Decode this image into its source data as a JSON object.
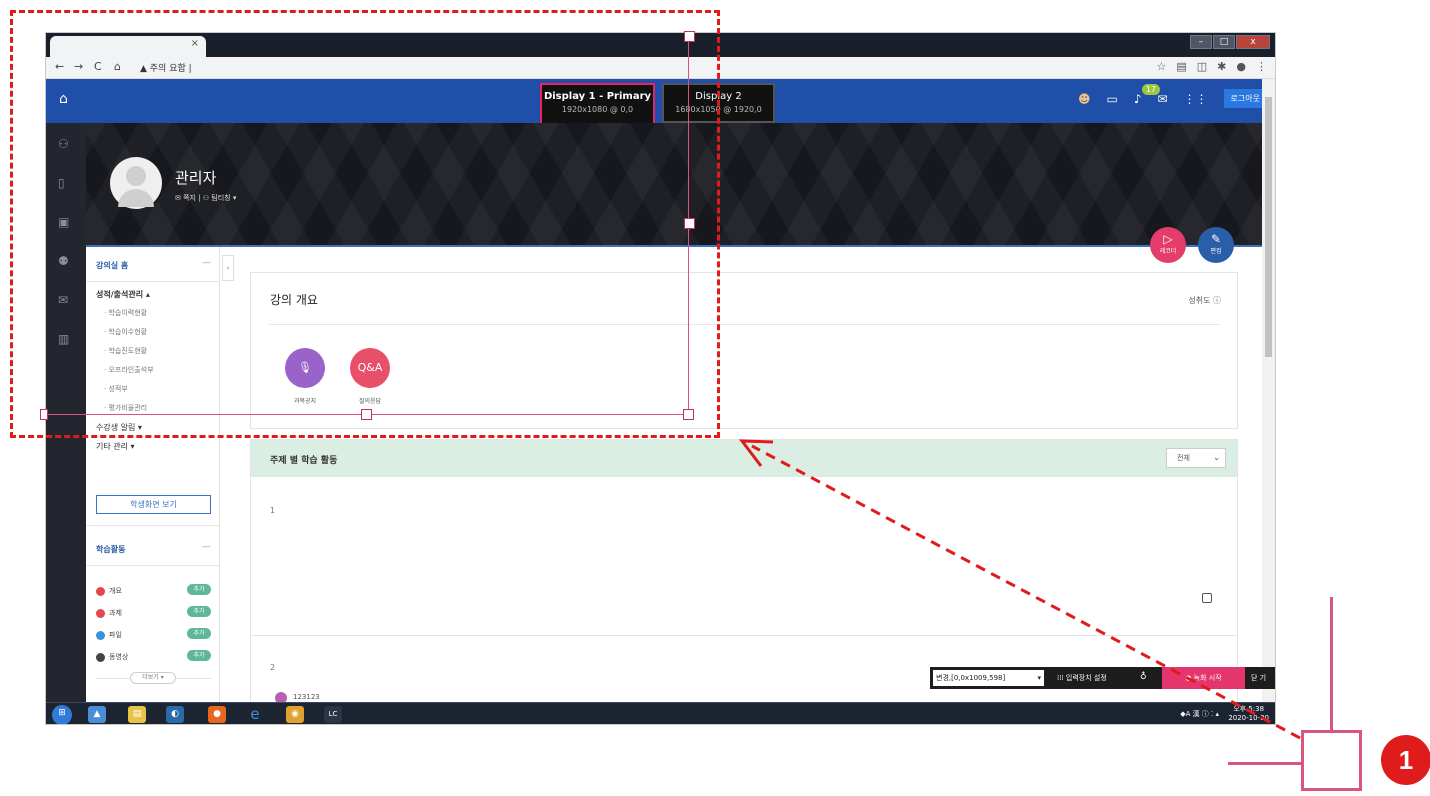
{
  "browser": {
    "tab_close": "×",
    "url_warning": "▲ 주의 요함 |",
    "window_buttons": [
      "–",
      "□",
      "x"
    ]
  },
  "header": {
    "displays": [
      {
        "name": "Display 1 - Primary",
        "resolution": "1920x1080 @ 0,0"
      },
      {
        "name": "Display 2",
        "resolution": "1680x1050 @ 1920,0"
      }
    ],
    "notification_count": "17",
    "logout_label": "로그아웃"
  },
  "profile": {
    "name": "관리자",
    "links": "✉ 쪽지 | ⚇ 팀티칭 ▾"
  },
  "fab": {
    "record_label": "레코더",
    "edit_label": "편집"
  },
  "left_menu": {
    "home_label": "강의실 홈",
    "home_dash": "—",
    "grades_label": "성적/출석관리 ▴",
    "grade_items": [
      "· 학습이력현황",
      "· 학습이수현황",
      "· 학습진도현황",
      "· 오프라인출석부",
      "· 성적부",
      "· 평가비율관리"
    ],
    "student_alerts": "수강생 알림 ▾",
    "other_mgmt": "기타 관리 ▾",
    "student_view_button": "학생화면 보기",
    "activities_label": "학습활동",
    "activities_dash": "—",
    "activities": [
      {
        "label": "개요",
        "color": "#e1494a"
      },
      {
        "label": "과제",
        "color": "#e1494a"
      },
      {
        "label": "파일",
        "color": "#3a92d8"
      },
      {
        "label": "동영상",
        "color": "#444444"
      }
    ],
    "add_label": "추가",
    "more_label": "더보기 ▾"
  },
  "overview": {
    "title": "강의 개요",
    "progress_label": "성취도 ⓘ",
    "notice_label": "과목공지",
    "qa_label": "질의응답",
    "qa_text": "Q&A"
  },
  "topics": {
    "title": "주제 별 학습 활동",
    "filter_value": "전체",
    "section1_number": "1",
    "section2_number": "2",
    "section2_item": "123123"
  },
  "recorder": {
    "region_value": "변경,[0,0x1009,598]",
    "input_settings": "⁞⁞⁞ 입력장치 설정",
    "start_label": "● 녹화 시작",
    "close_label": "닫 기"
  },
  "taskbar": {
    "tray_text": "◆A 漢 ⓘ ⁚ ▴",
    "clock_time": "오후 5:38",
    "clock_date": "2020-10-30"
  },
  "annotation": {
    "badge_number": "1"
  }
}
